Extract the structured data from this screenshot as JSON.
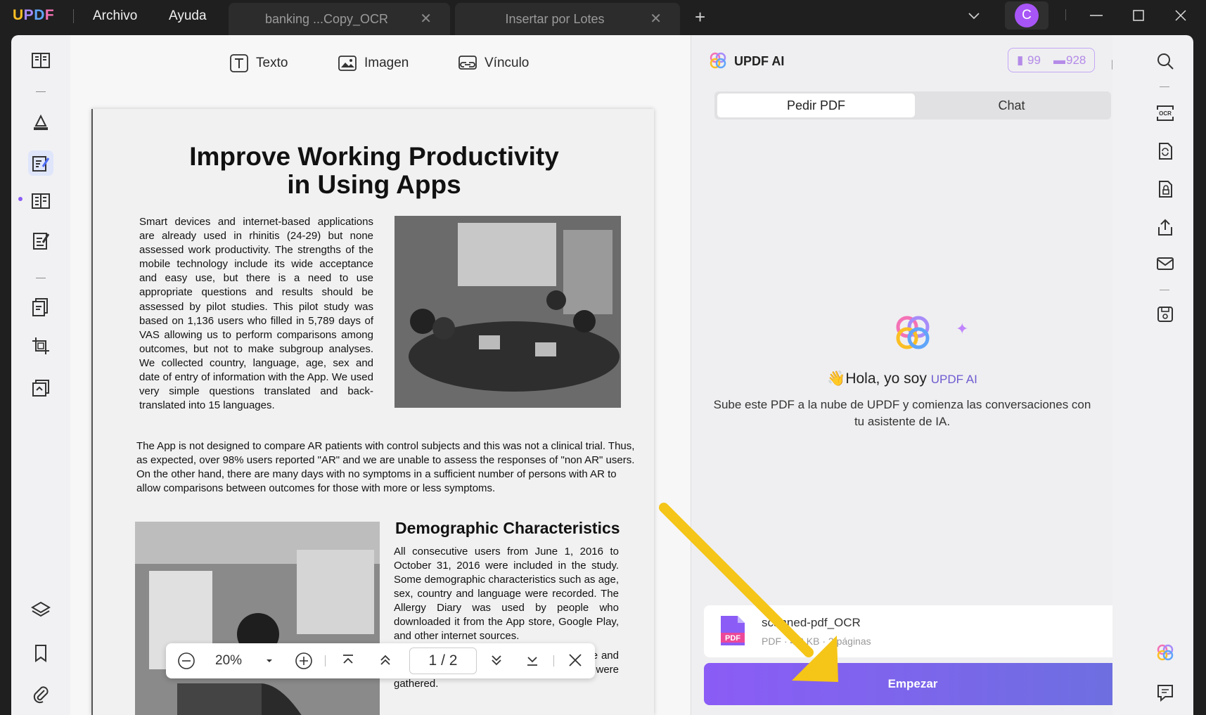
{
  "titlebar": {
    "logo": "UPDF",
    "menu": [
      "Archivo",
      "Ayuda"
    ],
    "tabs": [
      {
        "label": "banking ...Copy_OCR"
      },
      {
        "label": "Insertar por Lotes"
      }
    ],
    "avatar_letter": "C"
  },
  "toolbar": {
    "text_label": "Texto",
    "image_label": "Imagen",
    "link_label": "Vínculo"
  },
  "document": {
    "title_line1": "Improve Working Productivity",
    "title_line2": "in Using Apps",
    "para1": "Smart devices and internet-based applications are already used in rhinitis (24-29) but none assessed work productivity. The strengths of the mobile technology include its wide acceptance and easy use, but there is a need to use appropriate questions and results should be assessed by pilot studies. This pilot study was based on 1,136 users who filled in 5,789 days of VAS allowing us to perform comparisons among outcomes, but not to make subgroup analyses. We collected country, language, age, sex and date of entry of information with the App. We used very simple questions translated and back-translated into 15 languages.",
    "para2": "The App is not designed to compare AR patients with control subjects and this was not a clinical trial. Thus, as expected, over 98% users reported \"AR\" and we are unable to assess the responses of \"non AR\" users. On the other hand, there are many days with no symptoms in a sufficient number of persons with AR to allow comparisons between outcomes for those with more or less symptoms.",
    "heading2": "Demographic Characteristics",
    "para3": "All consecutive users from June 1, 2016 to October 31, 2016 were included in the study. Some demographic characteristics such as age, sex, country and language were recorded. The Allergy Diary was used by people who downloaded it from the App store, Google Play, and other internet sources.",
    "para4": "were app. Due to anonymization (i.e. name and address) of data, no personal identifiers were gathered."
  },
  "zoombar": {
    "zoom": "20%",
    "current_page": "1",
    "separator": "/",
    "total_pages": "2"
  },
  "ai_panel": {
    "title": "UPDF AI",
    "badge_pages": "99",
    "badge_msgs": "928",
    "tabs": [
      "Pedir PDF",
      "Chat"
    ],
    "greeting_emoji": "👋",
    "greeting": "Hola, yo soy",
    "greeting_brand": "UPDF AI",
    "description": "Sube este PDF a la nube de UPDF y comienza las conversaciones con tu asistente de IA.",
    "file_name": "scanned-pdf_OCR",
    "file_meta": "PDF · 4.3 KB · 2 páginas",
    "file_type": "PDF",
    "start_button": "Empezar"
  },
  "colors": {
    "accent": "#8b5cf6",
    "start_gradient_end": "#6d6fe0",
    "arrow": "#f5c518"
  }
}
